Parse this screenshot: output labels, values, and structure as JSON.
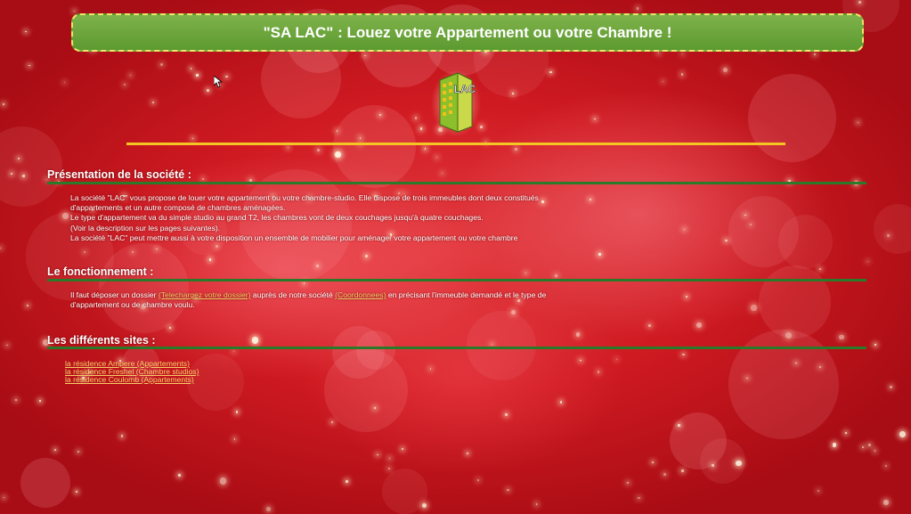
{
  "header": {
    "title": "\"SA LAC\" : Louez votre Appartement ou votre Chambre !"
  },
  "logo": {
    "text": "LAC",
    "icon": "building-logo-icon"
  },
  "sections": {
    "presentation": {
      "title": "Présentation de la société :",
      "lines": [
        "La société \"LAC\" vous propose de louer votre appartement ou votre chambre-studio. Elle dispose de trois immeubles dont deux constitués",
        "d'appartements et un autre composé de chambres aménagées.",
        "Le type d'appartement va du simple studio au grand T2, les chambres vont de deux couchages jusqu'à quatre couchages.",
        "(Voir la description sur les pages suivantes).",
        "La société \"LAC\" peut mettre aussi à votre disposition un ensemble de mobilier pour aménager votre appartement ou votre chambre"
      ]
    },
    "fonctionnement": {
      "title": "Le fonctionnement :",
      "text_1": "Il faut déposer un dossier ",
      "link_dossier": "(Telechargez votre dossier)",
      "text_2": " auprès de notre société ",
      "link_coordonnees": "(Coordonnees)",
      "text_3": " en précisant l'immeuble demandé et le type de",
      "text_4": "d'appartement ou de chambre voulu."
    },
    "sites": {
      "title": "Les différents sites :",
      "items": [
        "la résidence Ampere (Appartements)",
        "la résidence Freshel (Chambre studios)",
        "la résidence Coulomb (Appartements)"
      ]
    }
  },
  "colors": {
    "background": "#c8141c",
    "banner": "#6aa53c",
    "banner_border": "#f1e36b",
    "rule_yellow": "#f4c623",
    "rule_green": "#2a7a2a",
    "link": "#f3cf6a"
  }
}
